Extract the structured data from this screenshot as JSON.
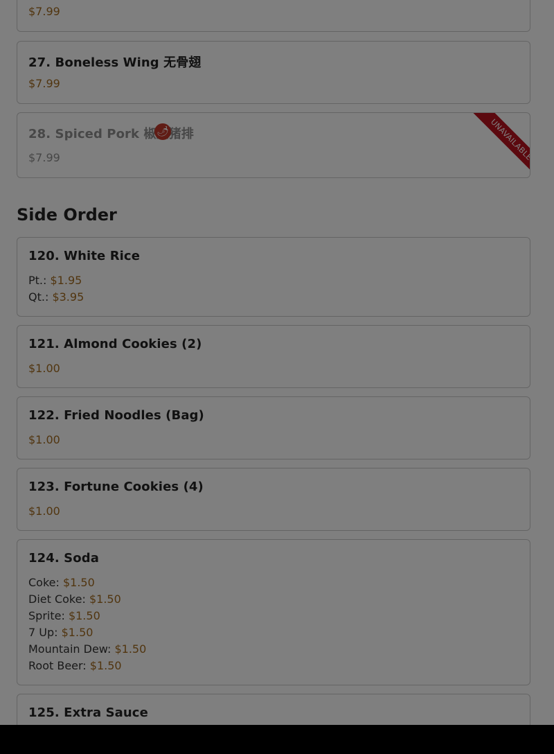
{
  "items": {
    "prev": {
      "price": "$7.99"
    },
    "i27": {
      "title": "27. Boneless Wing 无骨翅",
      "price": "$7.99"
    },
    "i28": {
      "title": "28. Spiced Pork 椒盐猪排",
      "price": "$7.99",
      "ribbon": "UNAVAILABLE",
      "spicy_icon": "chili-pepper"
    },
    "i120": {
      "title": "120. White Rice",
      "prices": [
        {
          "label": "Pt.:",
          "price": "$1.95"
        },
        {
          "label": "Qt.:",
          "price": "$3.95"
        }
      ]
    },
    "i121": {
      "title": "121. Almond Cookies (2)",
      "price": "$1.00"
    },
    "i122": {
      "title": "122. Fried Noodles (Bag)",
      "price": "$1.00"
    },
    "i123": {
      "title": "123. Fortune Cookies (4)",
      "price": "$1.00"
    },
    "i124": {
      "title": "124. Soda",
      "prices": [
        {
          "label": "Coke:",
          "price": "$1.50"
        },
        {
          "label": "Diet Coke:",
          "price": "$1.50"
        },
        {
          "label": "Sprite:",
          "price": "$1.50"
        },
        {
          "label": "7 Up:",
          "price": "$1.50"
        },
        {
          "label": "Mountain Dew:",
          "price": "$1.50"
        },
        {
          "label": "Root Beer:",
          "price": "$1.50"
        }
      ]
    },
    "i125": {
      "title": "125. Extra Sauce"
    }
  },
  "sections": {
    "side_order": "Side Order"
  },
  "colors": {
    "price": "#a36b1f",
    "ribbon": "#b8121e",
    "overlay": "rgba(0,0,0,0.5)"
  }
}
